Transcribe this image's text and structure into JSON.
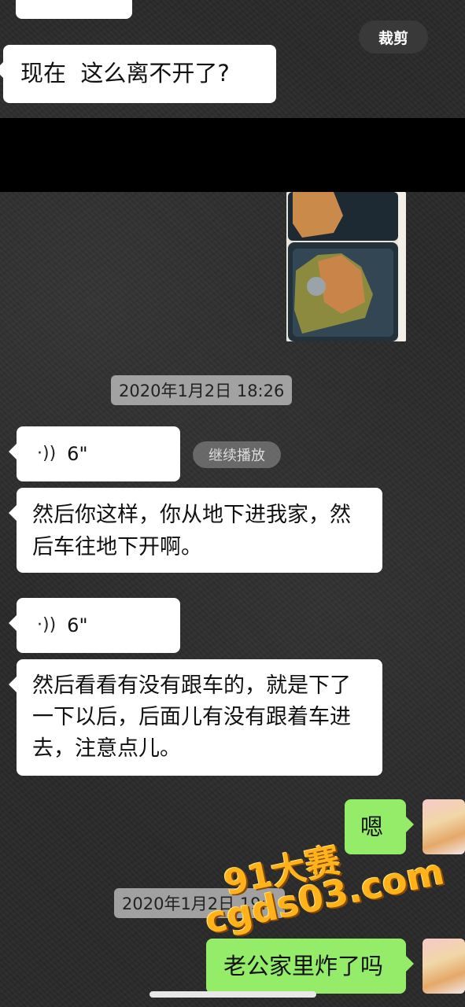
{
  "toolbar": {
    "crop_label": "裁剪"
  },
  "messages": {
    "top_bubble_partial": "",
    "top_bubble": "现在  这么离不开了?",
    "voice1_duration": "6\"",
    "resume_label": "继续播放",
    "text1": "然后你这样，你从地下进我家，然后车往地下开啊。",
    "voice2_duration": "6\"",
    "text2": "然后看看有没有跟车的，就是下了一下以后，后面儿有没有跟着车进去，注意点儿。",
    "reply1": "嗯",
    "reply2": "老公家里炸了吗"
  },
  "timestamps": {
    "ts1": "2020年1月2日 18:26",
    "ts2": "2020年1月2日 19:1"
  },
  "watermark": {
    "line1": "91大赛",
    "line2": "cgds03.com"
  },
  "colors": {
    "sent_bubble": "#95ec69",
    "received_bubble": "#ffffff",
    "watermark": "#ffb21a"
  },
  "icons": [
    "voice-icon",
    "avatar"
  ]
}
